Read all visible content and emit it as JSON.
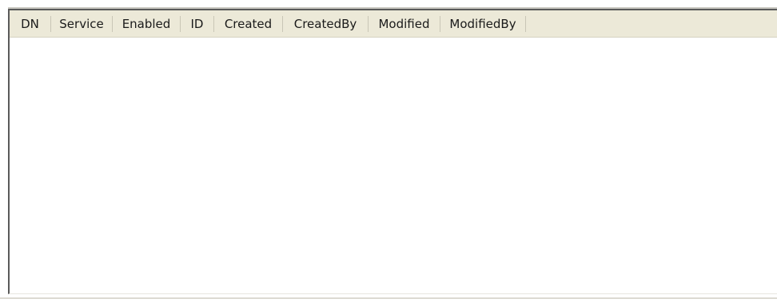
{
  "table": {
    "columns": [
      {
        "label": "DN"
      },
      {
        "label": "Service"
      },
      {
        "label": "Enabled"
      },
      {
        "label": "ID"
      },
      {
        "label": "Created"
      },
      {
        "label": "CreatedBy"
      },
      {
        "label": "Modified"
      },
      {
        "label": "ModifiedBy"
      }
    ],
    "rows": []
  },
  "colors": {
    "header_bg": "#ece9d8",
    "border_dark": "#5a5a5a",
    "body_bg": "#ffffff"
  }
}
